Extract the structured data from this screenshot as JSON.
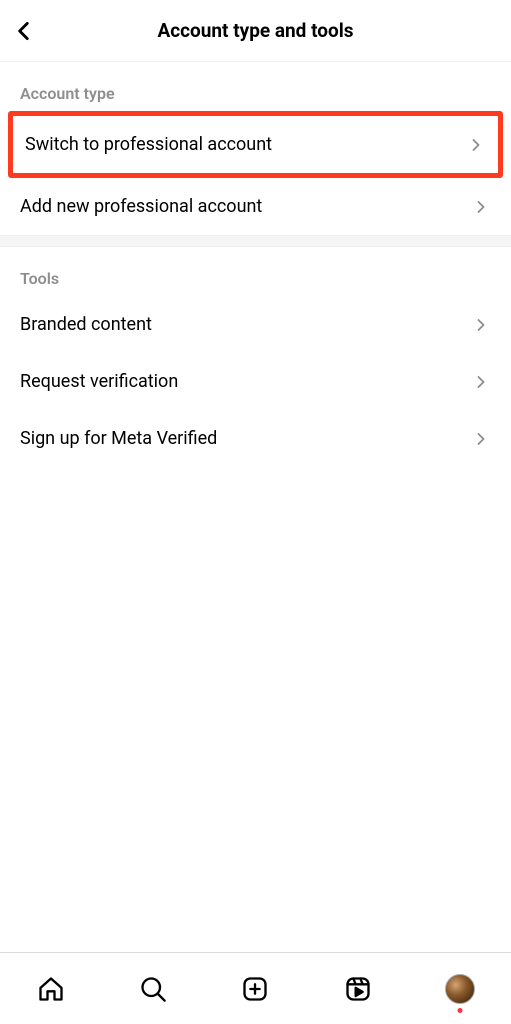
{
  "header": {
    "title": "Account type and tools"
  },
  "sections": {
    "account_type": {
      "header": "Account type",
      "items": {
        "switch_professional": "Switch to professional account",
        "add_professional": "Add new professional account"
      }
    },
    "tools": {
      "header": "Tools",
      "items": {
        "branded_content": "Branded content",
        "request_verification": "Request verification",
        "meta_verified": "Sign up for Meta Verified"
      }
    }
  }
}
